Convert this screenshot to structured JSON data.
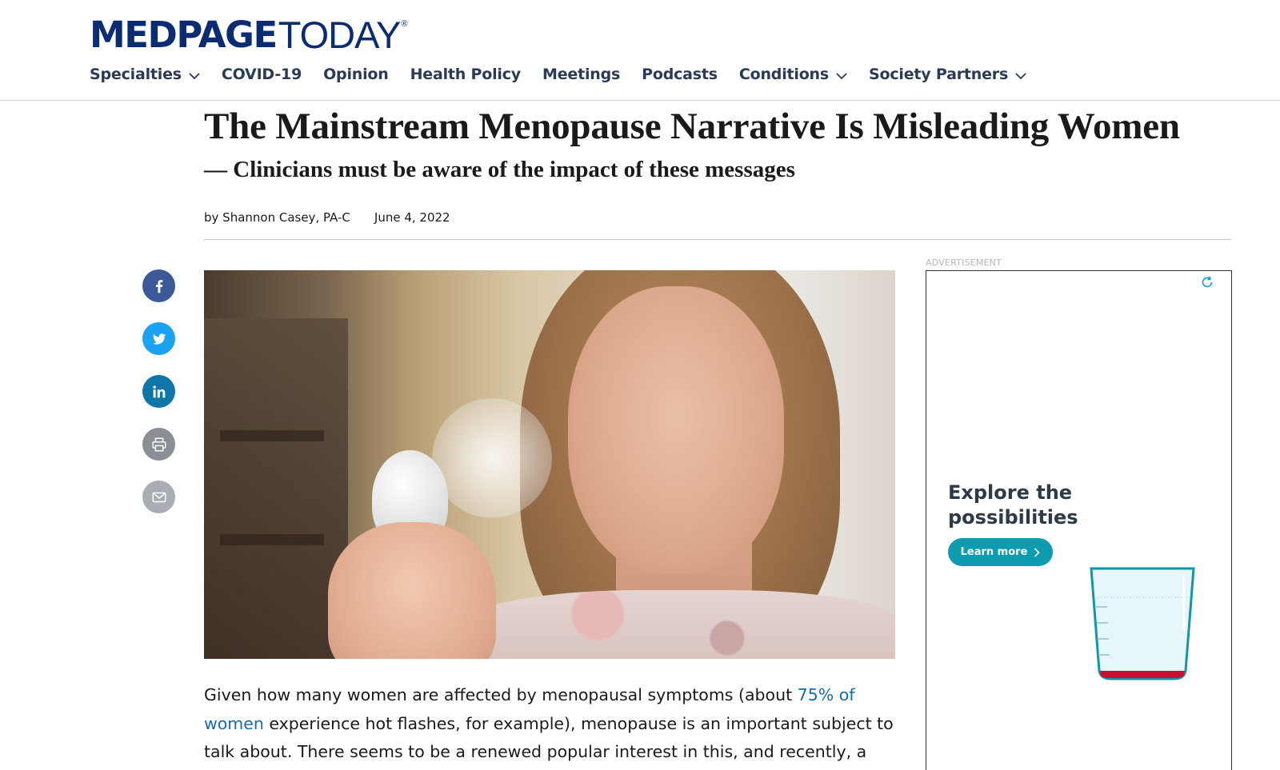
{
  "site": {
    "logo_bold": "MEDPAGE",
    "logo_light": "TODAY",
    "logo_reg": "®"
  },
  "nav": {
    "items": [
      {
        "label": "Specialties",
        "dropdown": true
      },
      {
        "label": "COVID-19",
        "dropdown": false
      },
      {
        "label": "Opinion",
        "dropdown": false
      },
      {
        "label": "Health Policy",
        "dropdown": false
      },
      {
        "label": "Meetings",
        "dropdown": false
      },
      {
        "label": "Podcasts",
        "dropdown": false
      },
      {
        "label": "Conditions",
        "dropdown": true
      },
      {
        "label": "Society Partners",
        "dropdown": true
      }
    ]
  },
  "article": {
    "title": "The Mainstream Menopause Narrative Is Misleading Women",
    "subtitle": "— Clinicians must be aware of the impact of these messages",
    "author": "by Shannon Casey, PA-C",
    "date": "June 4, 2022",
    "body": {
      "part1": "Given how many women are affected by menopausal symptoms (about ",
      "link": "75% of women",
      "part2": " experience hot flashes, for example), menopause is an important subject to talk about. There seems to be a renewed popular interest in this, and recently, a"
    }
  },
  "social": {
    "icons": [
      "facebook-icon",
      "twitter-icon",
      "linkedin-icon",
      "print-icon",
      "email-icon"
    ]
  },
  "ad": {
    "label": "ADVERTISEMENT",
    "headline": "Explore the possibilities",
    "button": "Learn more"
  },
  "colors": {
    "brand": "#0b2c73",
    "nav_text": "#2b3a55",
    "link": "#1a6ab0",
    "facebook": "#3b5998",
    "twitter": "#1da1f2",
    "linkedin": "#0e76a8",
    "ad_button": "#0d9bb0"
  }
}
